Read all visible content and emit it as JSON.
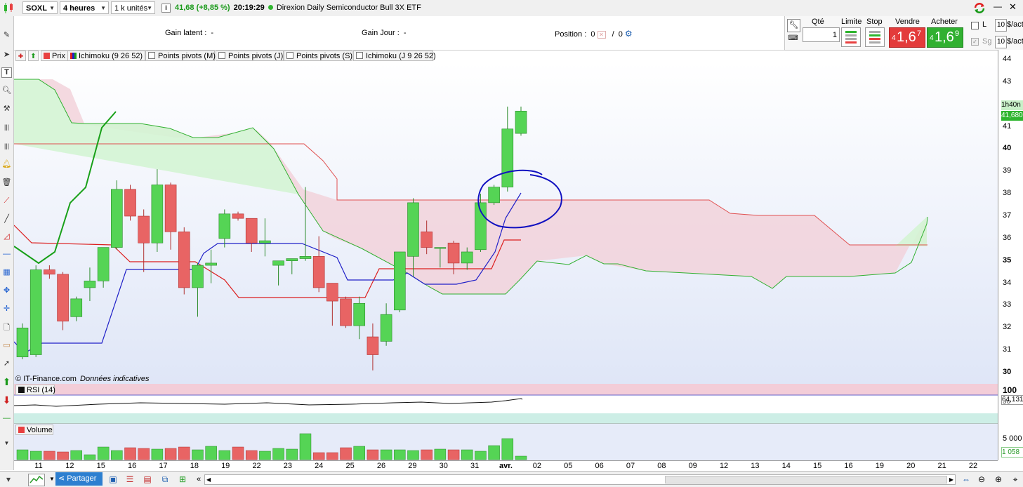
{
  "toolbar": {
    "symbol": "SOXL",
    "timeframe": "4 heures",
    "quantity_unit": "1 k unités",
    "info_icon": "i",
    "price": "41,68",
    "change": "(+8,85 %)",
    "time": "20:19:29",
    "instrument_name": "Direxion Daily Semiconductor Bull 3X ETF"
  },
  "infobar": {
    "gain_latent_label": "Gain latent :",
    "gain_latent_value": "-",
    "gain_jour_label": "Gain Jour :",
    "gain_jour_value": "-",
    "position_label": "Position :",
    "position_value_1": "0",
    "position_sep": "/",
    "position_value_2": "0"
  },
  "order_panel": {
    "qty_label": "Qté",
    "qty_value": "1",
    "limite_label": "Limite",
    "stop_label": "Stop",
    "vendre_label": "Vendre",
    "vendre_prefix": "4",
    "vendre_price": "1,6",
    "vendre_sup": "7",
    "acheter_label": "Acheter",
    "acheter_prefix": "4",
    "acheter_price": "1,6",
    "acheter_sup": "9",
    "l_label": "L",
    "sg_label": "Sg",
    "field1_value": "10",
    "field1_unit": "$/act",
    "field2_value": "10",
    "field2_unit": "$/act"
  },
  "legend": {
    "prix": "Prix",
    "ichimoku": "Ichimoku (9 26 52)",
    "pivots_m": "Points pivots (M)",
    "pivots_j": "Points pivots (J)",
    "pivots_s": "Points pivots (S)",
    "ichimoku_j": "Ichimoku (J 9 26 52)"
  },
  "chart": {
    "watermark_source": "© IT-Finance.com",
    "watermark_note": "Données indicatives",
    "y_ticks": [
      "44",
      "43",
      "42",
      "41",
      "40",
      "39",
      "38",
      "37",
      "36",
      "35",
      "34",
      "33",
      "32",
      "31",
      "30"
    ],
    "current_time_label": "1h40n",
    "current_price_label": "41,680",
    "rsi_label": "RSI (14)",
    "rsi_top_tick": "100",
    "rsi_value": "64,131",
    "rsi_lower_tick": "50",
    "volume_label": "Volume",
    "volume_tick": "5 000",
    "volume_value": "1 058",
    "x_ticks": [
      "11",
      "12",
      "15",
      "16",
      "17",
      "18",
      "19",
      "22",
      "23",
      "24",
      "25",
      "26",
      "29",
      "30",
      "31",
      "avr.",
      "02",
      "05",
      "06",
      "07",
      "08",
      "09",
      "12",
      "13",
      "14",
      "15",
      "16",
      "19",
      "20",
      "21",
      "22"
    ],
    "colors": {
      "bull": "#55d455",
      "bear": "#e86464",
      "cloud_bear": "#f2d2da",
      "cloud_bull": "#d4f4d4",
      "tenkan": "#2020c8",
      "kijun": "#dc1e1e",
      "chikou": "#18a018",
      "annotation": "#1010c0"
    }
  },
  "chart_data": {
    "type": "candlestick",
    "x": [
      "11",
      "12",
      "15",
      "16",
      "17",
      "18",
      "19",
      "22",
      "23",
      "24",
      "25",
      "26",
      "29",
      "30",
      "31",
      "avr."
    ],
    "ylim": [
      29.5,
      44.5
    ],
    "candles": [
      {
        "o": 30.7,
        "h": 32.2,
        "l": 30.6,
        "c": 32.0
      },
      {
        "o": 30.8,
        "h": 34.8,
        "l": 30.7,
        "c": 34.6
      },
      {
        "o": 34.6,
        "h": 34.8,
        "l": 34.2,
        "c": 34.4
      },
      {
        "o": 34.4,
        "h": 34.5,
        "l": 31.9,
        "c": 32.3
      },
      {
        "o": 32.5,
        "h": 33.4,
        "l": 32.3,
        "c": 33.3
      },
      {
        "o": 33.8,
        "h": 34.7,
        "l": 33.2,
        "c": 34.1
      },
      {
        "o": 34.1,
        "h": 35.5,
        "l": 33.8,
        "c": 35.6
      },
      {
        "o": 35.6,
        "h": 38.6,
        "l": 35.5,
        "c": 38.2
      },
      {
        "o": 38.2,
        "h": 38.4,
        "l": 36.8,
        "c": 37.0
      },
      {
        "o": 37.0,
        "h": 37.3,
        "l": 34.5,
        "c": 35.8
      },
      {
        "o": 35.8,
        "h": 39.1,
        "l": 35.4,
        "c": 38.4
      },
      {
        "o": 38.4,
        "h": 38.5,
        "l": 35.5,
        "c": 36.3
      },
      {
        "o": 36.3,
        "h": 36.5,
        "l": 33.5,
        "c": 33.8
      },
      {
        "o": 33.8,
        "h": 34.9,
        "l": 32.5,
        "c": 34.8
      },
      {
        "o": 34.8,
        "h": 35.5,
        "l": 34.0,
        "c": 34.9
      },
      {
        "o": 36.0,
        "h": 37.3,
        "l": 35.6,
        "c": 37.1
      },
      {
        "o": 37.1,
        "h": 37.2,
        "l": 36.8,
        "c": 36.9
      },
      {
        "o": 36.9,
        "h": 36.9,
        "l": 35.4,
        "c": 35.8
      },
      {
        "o": 35.8,
        "h": 36.9,
        "l": 35.2,
        "c": 35.9
      },
      {
        "o": 34.8,
        "h": 34.8,
        "l": 33.9,
        "c": 35.0
      },
      {
        "o": 35.0,
        "h": 35.1,
        "l": 34.4,
        "c": 35.1
      },
      {
        "o": 35.1,
        "h": 38.3,
        "l": 35.0,
        "c": 35.2
      },
      {
        "o": 35.2,
        "h": 36.1,
        "l": 33.6,
        "c": 33.8
      },
      {
        "o": 34.0,
        "h": 34.0,
        "l": 32.1,
        "c": 33.2
      },
      {
        "o": 33.3,
        "h": 33.4,
        "l": 32.0,
        "c": 32.1
      },
      {
        "o": 32.1,
        "h": 33.4,
        "l": 31.5,
        "c": 33.1
      },
      {
        "o": 31.6,
        "h": 32.2,
        "l": 30.1,
        "c": 30.8
      },
      {
        "o": 31.4,
        "h": 33.1,
        "l": 31.2,
        "c": 32.6
      },
      {
        "o": 32.8,
        "h": 35.4,
        "l": 32.7,
        "c": 35.4
      },
      {
        "o": 35.2,
        "h": 37.8,
        "l": 34.3,
        "c": 37.6
      },
      {
        "o": 36.3,
        "h": 36.8,
        "l": 35.3,
        "c": 35.6
      },
      {
        "o": 35.6,
        "h": 35.6,
        "l": 34.7,
        "c": 35.6
      },
      {
        "o": 35.8,
        "h": 35.9,
        "l": 34.4,
        "c": 34.9
      },
      {
        "o": 34.9,
        "h": 35.6,
        "l": 34.6,
        "c": 35.4
      },
      {
        "o": 35.5,
        "h": 38.0,
        "l": 35.4,
        "c": 37.6
      },
      {
        "o": 37.6,
        "h": 38.4,
        "l": 37.5,
        "c": 38.3
      },
      {
        "o": 38.3,
        "h": 41.9,
        "l": 38.1,
        "c": 40.9
      },
      {
        "o": 40.7,
        "h": 41.9,
        "l": 40.6,
        "c": 41.7
      }
    ],
    "series": [
      {
        "name": "Ichimoku (9 26 52)"
      }
    ],
    "rsi": {
      "value": 64.131
    },
    "volume": {
      "last": 1058
    }
  }
}
